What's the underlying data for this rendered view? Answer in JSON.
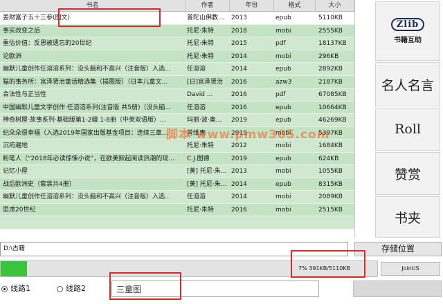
{
  "table": {
    "headers": [
      "书名",
      "作者",
      "年份",
      "格式",
      "大小"
    ],
    "rows": [
      {
        "title": "姜财富子五十三参(图文)",
        "author": "普陀山佛教...",
        "year": "2013",
        "format": "epub",
        "size": "5110KB"
      },
      {
        "title": "事实改变之后",
        "author": "托尼·朱特",
        "year": "2018",
        "format": "mobi",
        "size": "2555KB"
      },
      {
        "title": "重估价值：反思被遗忘的20世纪",
        "author": "托尼·朱特",
        "year": "2015",
        "format": "pdf",
        "size": "18137KB"
      },
      {
        "title": "论欧洲",
        "author": "托尼·朱特",
        "year": "2014",
        "format": "mobi",
        "size": "296KB"
      },
      {
        "title": "幽默儿童创作任溶溶系列：没头脑和不高兴（注音版）入选...",
        "author": "任溶溶",
        "year": "2014",
        "format": "epub",
        "size": "2892KB"
      },
      {
        "title": "猫的事务所：宫泽贤治童话精选集（插图版）（日本儿童文...",
        "author": "[日]宫泽贤治",
        "year": "2016",
        "format": "azw3",
        "size": "2187KB"
      },
      {
        "title": "合法性与正当性",
        "author": "David ...",
        "year": "2016",
        "format": "pdf",
        "size": "67085KB"
      },
      {
        "title": "中国幽默儿童文学创作·任溶溶系列(注音版 共5册)（没头脑...",
        "author": "任溶溶",
        "year": "2016",
        "format": "epub",
        "size": "10664KB"
      },
      {
        "title": "神奇树屋·故事系列·基础版第1-2辑 1-8册（中英双语版）...",
        "author": "玛丽·波·奥...",
        "year": "2019",
        "format": "epub",
        "size": "46269KB"
      },
      {
        "title": "纪朵朵很幸福（入选2019年国家出版基金项目：连续三章...",
        "author": "曾维惠",
        "year": "2019",
        "format": "mobi",
        "size": "5397KB"
      },
      {
        "title": "沉疴遍地",
        "author": "托尼·朱特",
        "year": "2012",
        "format": "mobi",
        "size": "1684KB"
      },
      {
        "title": "粉笔人（“2018年必读惊悚小说”，在欧美掀起阅读热潮的现...",
        "author": "C.J.图德",
        "year": "2019",
        "format": "epub",
        "size": "624KB"
      },
      {
        "title": "记忆小屋",
        "author": "[美] 托尼·朱...",
        "year": "2013",
        "format": "mobi",
        "size": "1055KB"
      },
      {
        "title": "战后欧洲史（套装共4册）",
        "author": "[美] 托尼·朱...",
        "year": "2014",
        "format": "epub",
        "size": "8315KB"
      },
      {
        "title": "幽默儿童创作任溶溶系列：没头脑和不高兴（注音版）入选...",
        "author": "任溶溶",
        "year": "2014",
        "format": "mobi",
        "size": "2089KB"
      },
      {
        "title": "思虑20世纪",
        "author": "托尼·朱特",
        "year": "2016",
        "format": "mobi",
        "size": "2515KB"
      },
      {
        "title": "",
        "author": "",
        "year": "",
        "format": "",
        "size": ""
      }
    ]
  },
  "panel": {
    "logo_text": "Zlib",
    "logo_sub": "书籍互助",
    "buttons": [
      "名人名言",
      "Roll",
      "赞赏",
      "书夹"
    ]
  },
  "bottom": {
    "path_value": "D:\\古籍",
    "save_label": "存储位置",
    "progress_percent": 7,
    "progress_text": "7%   391KB/5110KB",
    "joinus_label": "JoinUS",
    "radio_route1": "线路1",
    "radio_route2": "线路2",
    "selected_route": "线路1",
    "search_value": "三童图"
  },
  "watermark": "脚本 www.pmw365.com",
  "colors": {
    "row_green": "#cfe8cf",
    "row_selected": "#ffffff",
    "progress_green": "#3cc43c",
    "annotation_red": "#d42a2a"
  }
}
